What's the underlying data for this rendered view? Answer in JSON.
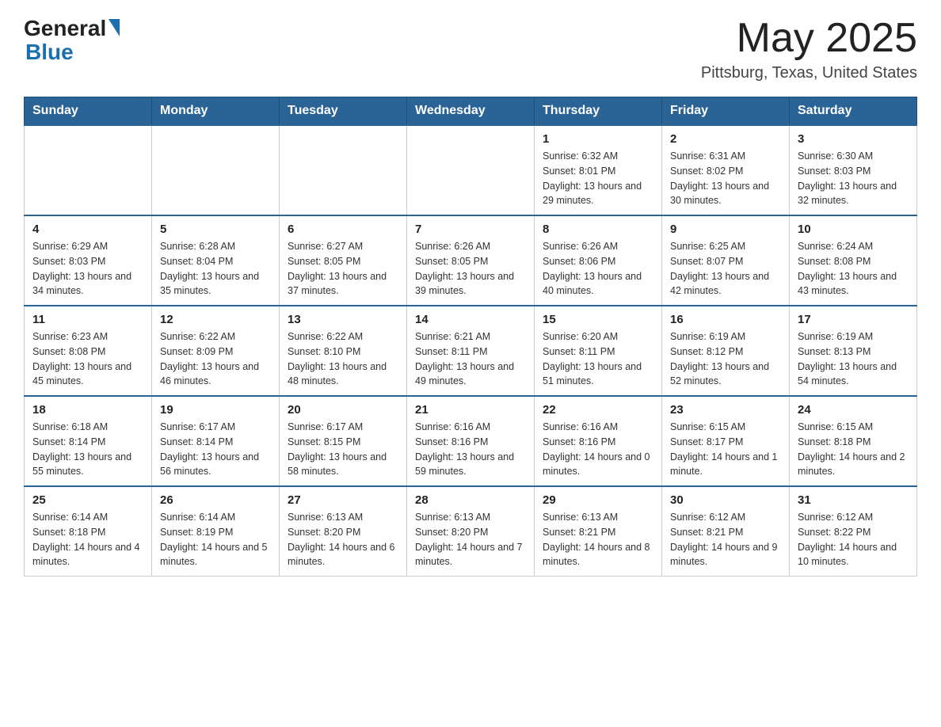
{
  "header": {
    "logo": {
      "general": "General",
      "triangle": "▲",
      "blue": "Blue"
    },
    "title": "May 2025",
    "location": "Pittsburg, Texas, United States"
  },
  "days_of_week": [
    "Sunday",
    "Monday",
    "Tuesday",
    "Wednesday",
    "Thursday",
    "Friday",
    "Saturday"
  ],
  "weeks": [
    [
      {
        "day": "",
        "info": ""
      },
      {
        "day": "",
        "info": ""
      },
      {
        "day": "",
        "info": ""
      },
      {
        "day": "",
        "info": ""
      },
      {
        "day": "1",
        "info": "Sunrise: 6:32 AM\nSunset: 8:01 PM\nDaylight: 13 hours and 29 minutes."
      },
      {
        "day": "2",
        "info": "Sunrise: 6:31 AM\nSunset: 8:02 PM\nDaylight: 13 hours and 30 minutes."
      },
      {
        "day": "3",
        "info": "Sunrise: 6:30 AM\nSunset: 8:03 PM\nDaylight: 13 hours and 32 minutes."
      }
    ],
    [
      {
        "day": "4",
        "info": "Sunrise: 6:29 AM\nSunset: 8:03 PM\nDaylight: 13 hours and 34 minutes."
      },
      {
        "day": "5",
        "info": "Sunrise: 6:28 AM\nSunset: 8:04 PM\nDaylight: 13 hours and 35 minutes."
      },
      {
        "day": "6",
        "info": "Sunrise: 6:27 AM\nSunset: 8:05 PM\nDaylight: 13 hours and 37 minutes."
      },
      {
        "day": "7",
        "info": "Sunrise: 6:26 AM\nSunset: 8:05 PM\nDaylight: 13 hours and 39 minutes."
      },
      {
        "day": "8",
        "info": "Sunrise: 6:26 AM\nSunset: 8:06 PM\nDaylight: 13 hours and 40 minutes."
      },
      {
        "day": "9",
        "info": "Sunrise: 6:25 AM\nSunset: 8:07 PM\nDaylight: 13 hours and 42 minutes."
      },
      {
        "day": "10",
        "info": "Sunrise: 6:24 AM\nSunset: 8:08 PM\nDaylight: 13 hours and 43 minutes."
      }
    ],
    [
      {
        "day": "11",
        "info": "Sunrise: 6:23 AM\nSunset: 8:08 PM\nDaylight: 13 hours and 45 minutes."
      },
      {
        "day": "12",
        "info": "Sunrise: 6:22 AM\nSunset: 8:09 PM\nDaylight: 13 hours and 46 minutes."
      },
      {
        "day": "13",
        "info": "Sunrise: 6:22 AM\nSunset: 8:10 PM\nDaylight: 13 hours and 48 minutes."
      },
      {
        "day": "14",
        "info": "Sunrise: 6:21 AM\nSunset: 8:11 PM\nDaylight: 13 hours and 49 minutes."
      },
      {
        "day": "15",
        "info": "Sunrise: 6:20 AM\nSunset: 8:11 PM\nDaylight: 13 hours and 51 minutes."
      },
      {
        "day": "16",
        "info": "Sunrise: 6:19 AM\nSunset: 8:12 PM\nDaylight: 13 hours and 52 minutes."
      },
      {
        "day": "17",
        "info": "Sunrise: 6:19 AM\nSunset: 8:13 PM\nDaylight: 13 hours and 54 minutes."
      }
    ],
    [
      {
        "day": "18",
        "info": "Sunrise: 6:18 AM\nSunset: 8:14 PM\nDaylight: 13 hours and 55 minutes."
      },
      {
        "day": "19",
        "info": "Sunrise: 6:17 AM\nSunset: 8:14 PM\nDaylight: 13 hours and 56 minutes."
      },
      {
        "day": "20",
        "info": "Sunrise: 6:17 AM\nSunset: 8:15 PM\nDaylight: 13 hours and 58 minutes."
      },
      {
        "day": "21",
        "info": "Sunrise: 6:16 AM\nSunset: 8:16 PM\nDaylight: 13 hours and 59 minutes."
      },
      {
        "day": "22",
        "info": "Sunrise: 6:16 AM\nSunset: 8:16 PM\nDaylight: 14 hours and 0 minutes."
      },
      {
        "day": "23",
        "info": "Sunrise: 6:15 AM\nSunset: 8:17 PM\nDaylight: 14 hours and 1 minute."
      },
      {
        "day": "24",
        "info": "Sunrise: 6:15 AM\nSunset: 8:18 PM\nDaylight: 14 hours and 2 minutes."
      }
    ],
    [
      {
        "day": "25",
        "info": "Sunrise: 6:14 AM\nSunset: 8:18 PM\nDaylight: 14 hours and 4 minutes."
      },
      {
        "day": "26",
        "info": "Sunrise: 6:14 AM\nSunset: 8:19 PM\nDaylight: 14 hours and 5 minutes."
      },
      {
        "day": "27",
        "info": "Sunrise: 6:13 AM\nSunset: 8:20 PM\nDaylight: 14 hours and 6 minutes."
      },
      {
        "day": "28",
        "info": "Sunrise: 6:13 AM\nSunset: 8:20 PM\nDaylight: 14 hours and 7 minutes."
      },
      {
        "day": "29",
        "info": "Sunrise: 6:13 AM\nSunset: 8:21 PM\nDaylight: 14 hours and 8 minutes."
      },
      {
        "day": "30",
        "info": "Sunrise: 6:12 AM\nSunset: 8:21 PM\nDaylight: 14 hours and 9 minutes."
      },
      {
        "day": "31",
        "info": "Sunrise: 6:12 AM\nSunset: 8:22 PM\nDaylight: 14 hours and 10 minutes."
      }
    ]
  ]
}
